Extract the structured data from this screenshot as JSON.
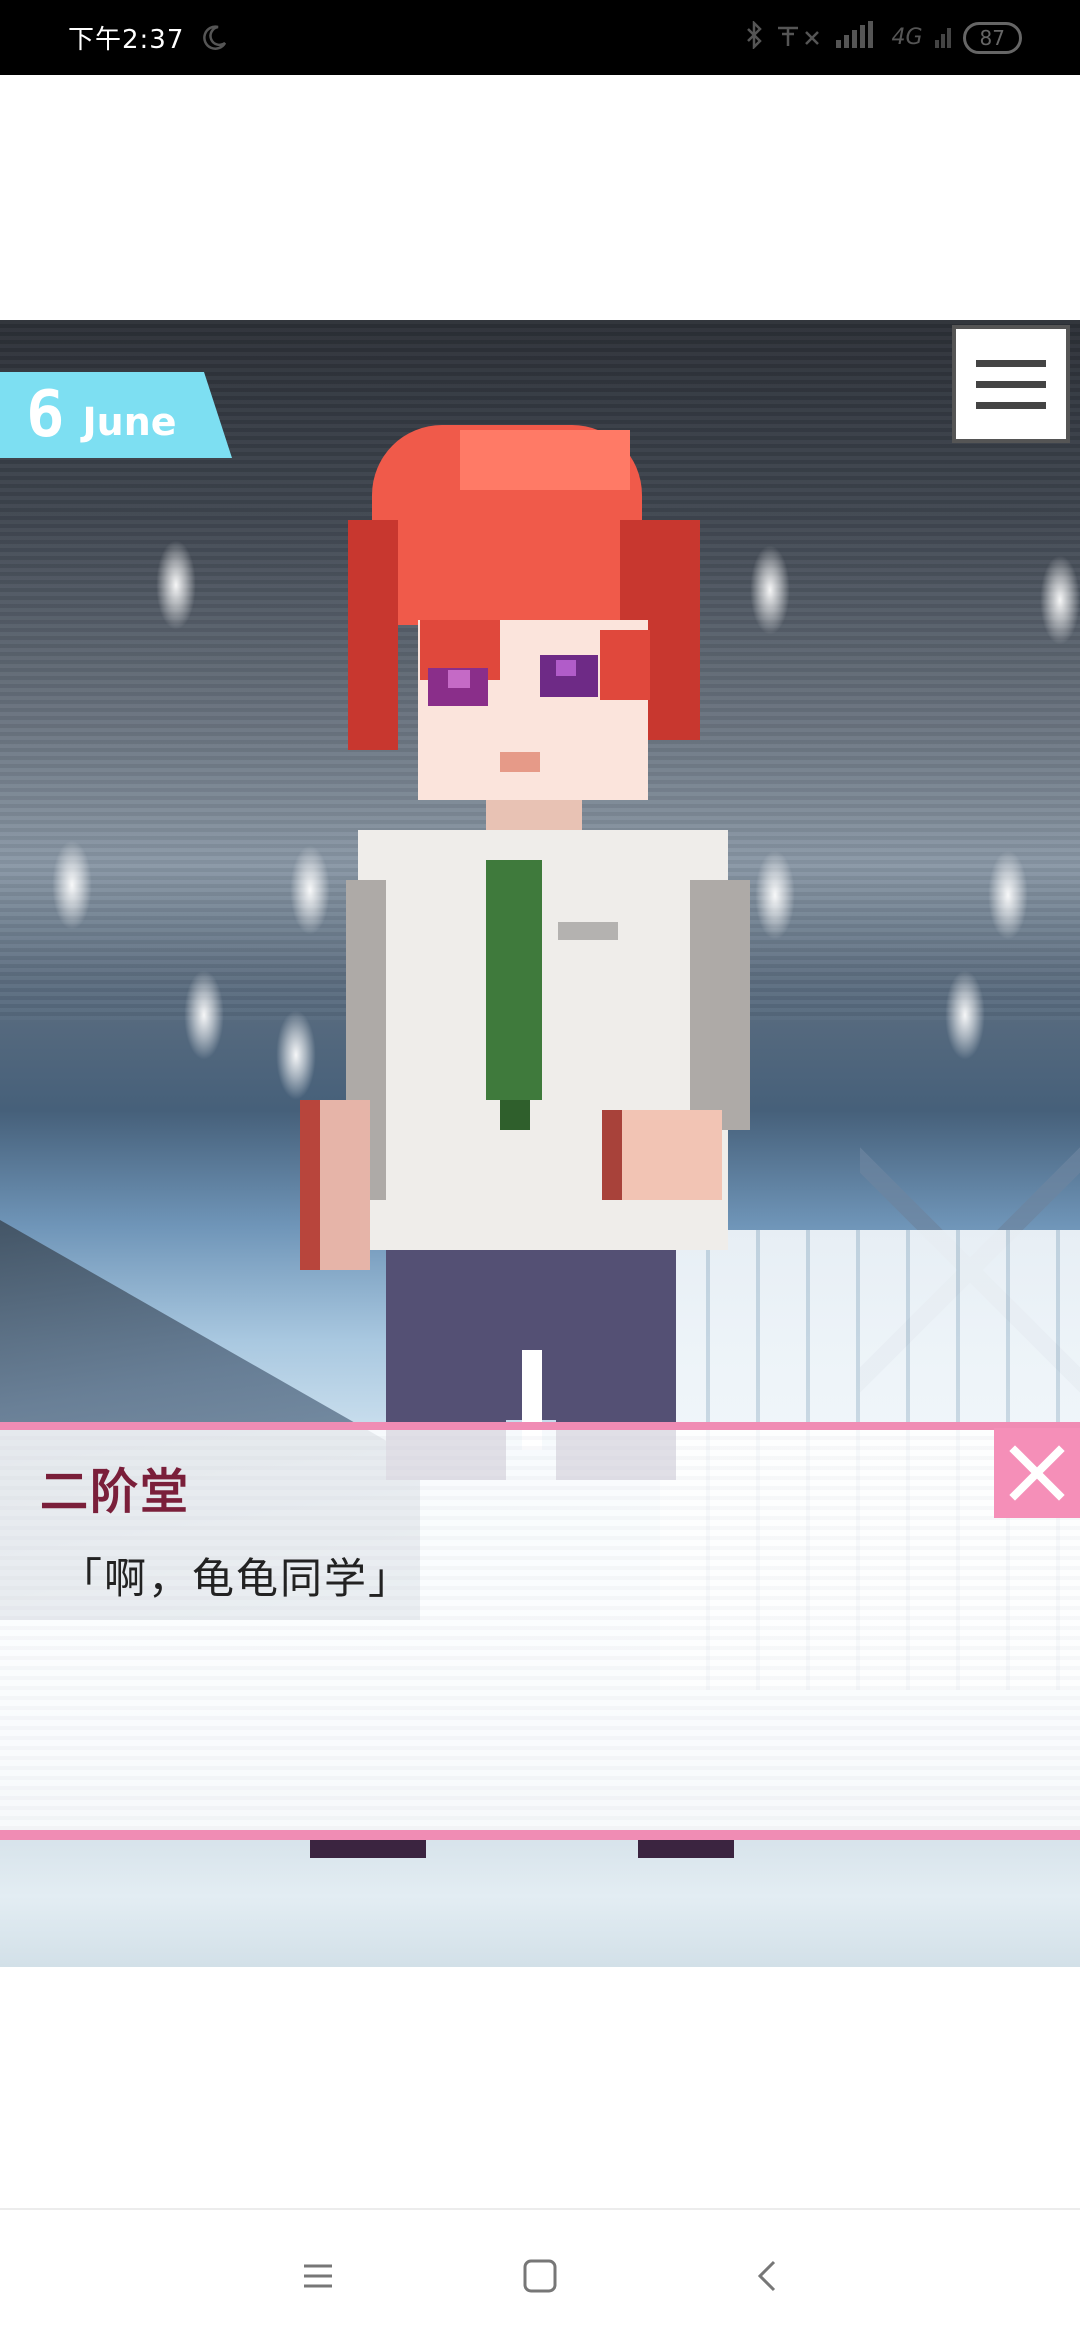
{
  "status_bar": {
    "time": "下午2:37",
    "battery": "87",
    "network": "4G"
  },
  "scene": {
    "date_day": "6",
    "date_month": "June"
  },
  "dialogue": {
    "speaker": "二阶堂",
    "line": "「啊，龟龟同学」"
  },
  "colors": {
    "ribbon": "#7ddff2",
    "dialogue_border": "#f08cb4",
    "speaker_name": "#7a1f3a",
    "close_button": "#f58fb8"
  },
  "icons": {
    "menu": "hamburger-icon",
    "close": "close-icon",
    "nav_menu": "nav-menu-icon",
    "nav_home": "nav-home-icon",
    "nav_back": "nav-back-icon"
  }
}
